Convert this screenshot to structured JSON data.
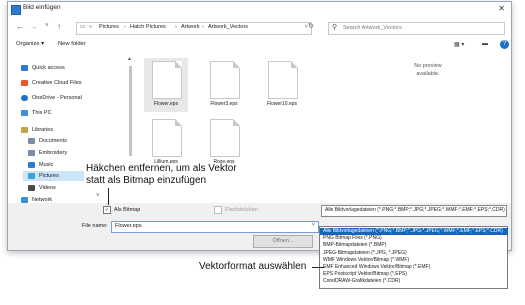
{
  "window": {
    "title": "Bild einfügen"
  },
  "nav": {
    "breadcrumb": [
      "«",
      "Pictures",
      "Hatch Pictures",
      "Artwork",
      "Artwork_Vectors"
    ],
    "search_placeholder": "Search Artwork_Vectors"
  },
  "toolbar": {
    "organize": "Organize ▾",
    "new_folder": "New folder"
  },
  "sidebar": {
    "items": [
      {
        "label": "Quick access",
        "icon": "star-icon",
        "color": "#2b7bd6"
      },
      {
        "label": "Creative Cloud Files",
        "icon": "cloud-icon",
        "color": "#e8562a"
      },
      {
        "label": "OneDrive - Personal",
        "icon": "onedrive-icon",
        "color": "#1e72c8"
      },
      {
        "label": "This PC",
        "icon": "pc-icon",
        "color": "#3b8fd6"
      },
      {
        "label": "Libraries",
        "icon": "library-icon",
        "color": "#c9a14a"
      },
      {
        "label": "Documents",
        "icon": "documents-icon",
        "color": "#7a8da6"
      },
      {
        "label": "Embroidery",
        "icon": "embroidery-icon",
        "color": "#7a8da6"
      },
      {
        "label": "Music",
        "icon": "music-icon",
        "color": "#2b7bd6"
      },
      {
        "label": "Pictures",
        "icon": "pictures-icon",
        "color": "#3fa0d8"
      },
      {
        "label": "Videos",
        "icon": "videos-icon",
        "color": "#4a4a4a"
      },
      {
        "label": "Network",
        "icon": "network-icon",
        "color": "#3b8fd6"
      }
    ]
  },
  "files": [
    {
      "name": "Flower.eps"
    },
    {
      "name": "Flower3.eps"
    },
    {
      "name": "Flower10.eps"
    },
    {
      "name": "Lillium.eps"
    },
    {
      "name": "Rose.eps"
    }
  ],
  "preview": {
    "line1": "No preview",
    "line2": "available."
  },
  "bottom": {
    "as_bitmap": "Als Bitmap",
    "flat": "Flachdrücken",
    "filename_label": "File name:",
    "filename_value": "Flower.eps",
    "filter_value": "Alle Bildvorlagedateien (*.PNG;*.BMP;*.JPG;*.JPEG;*.WMF;*.EMF;*.EPS;*.CDR)",
    "open_button": "Öffnen..."
  },
  "dropdown": {
    "options": [
      "Alle Bildvorlagedateien (*.PNG;*.BMP;*.JPG;*.JPEG;*.WMF;*.EMF;*.EPS;*.CDR)",
      "PNG Bitmap Files (*.PNG)",
      "BMP-Bitmapdateien (*.BMP)",
      "JPEG-Bitmapdateien (*.JPG, *.JPEG)",
      "WMF Windows Vektor/Bitmap (*.WMF)",
      "EMF Enhanced Windows Vektor/Bitmap (*.EMF)",
      "EPS Postscript Vektor/Bitmap (*.EPS)",
      "CorelDRAW-Grafikdateien (*.CDR)"
    ]
  },
  "callouts": {
    "bitmap_line1": "Häkchen entfernen, um als Vektor",
    "bitmap_line2": "statt als Bitmap einzufügen",
    "vector": "Vektorformat auswählen"
  },
  "colors": {
    "accent": "#1565c0",
    "selection": "#cce4f7"
  }
}
